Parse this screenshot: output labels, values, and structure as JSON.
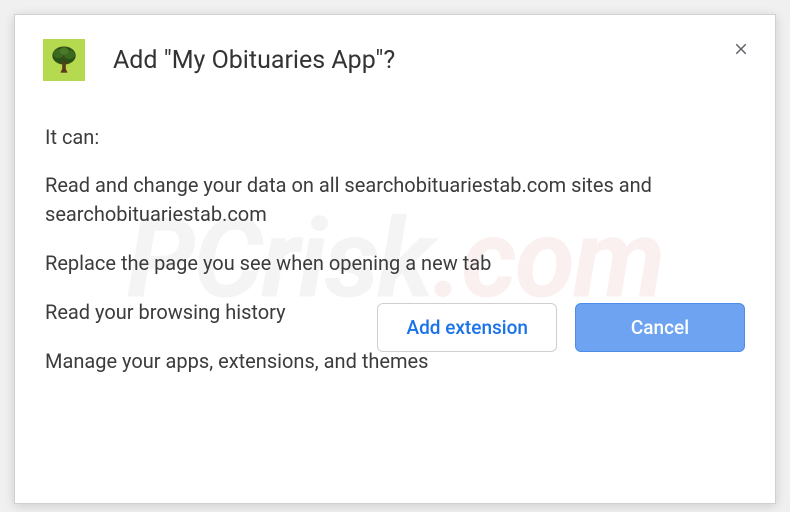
{
  "dialog": {
    "title": "Add \"My Obituaries App\"?",
    "intro": "It can:",
    "permissions": [
      "Read and change your data on all searchobituariestab.com sites and searchobituariestab.com",
      "Replace the page you see when opening a new tab",
      "Read your browsing history",
      "Manage your apps, extensions, and themes"
    ],
    "buttons": {
      "add": "Add extension",
      "cancel": "Cancel"
    }
  },
  "watermark": {
    "prefix": "PCrisk",
    "suffix": ".com"
  }
}
